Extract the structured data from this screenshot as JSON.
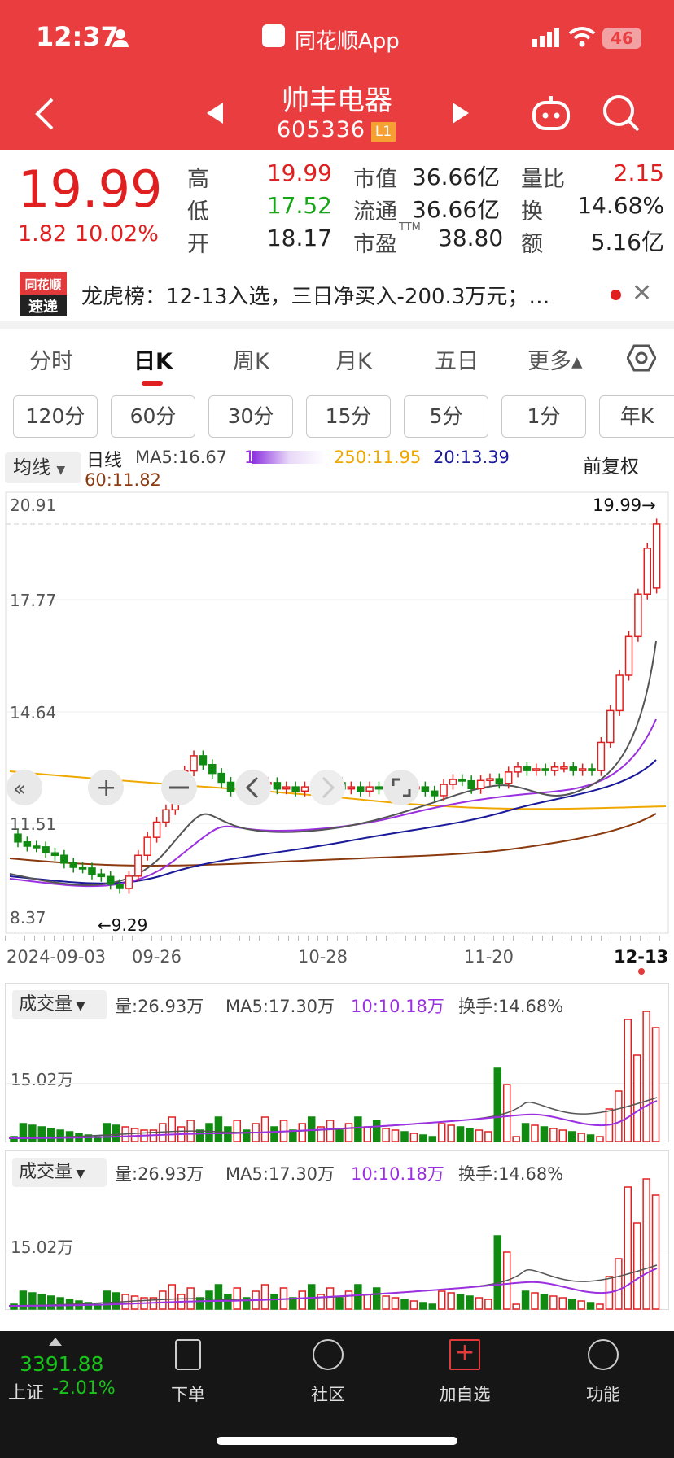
{
  "status": {
    "time": "12:37",
    "app": "同花顺App",
    "battery": "46"
  },
  "title": {
    "name": "帅丰电器",
    "code": "605336",
    "level": "L1"
  },
  "quote": {
    "price": "19.99",
    "change": "1.82",
    "change_pct": "10.02%",
    "high_label": "高",
    "high": "19.99",
    "low_label": "低",
    "low": "17.52",
    "open_label": "开",
    "open": "18.17",
    "mcap_label": "市值",
    "mcap": "36.66亿",
    "float_label": "流通",
    "float": "36.66亿",
    "pe_label": "市盈",
    "pe_sup": "TTM",
    "pe": "38.80",
    "vr_label": "量比",
    "vr": "2.15",
    "turn_label": "换",
    "turn": "14.68%",
    "amt_label": "额",
    "amt": "5.16亿"
  },
  "news": {
    "logo_top": "同花顺",
    "logo_bottom": "速递",
    "text": "龙虎榜：12-13入选，三日净买入-200.3万元；…"
  },
  "tabs": [
    "分时",
    "日K",
    "周K",
    "月K",
    "五日",
    "更多▴"
  ],
  "periods": [
    "120分",
    "60分",
    "30分",
    "15分",
    "5分",
    "1分",
    "年K"
  ],
  "legend": {
    "selector": "均线",
    "daily": "日线",
    "ma5": "MA5:16.67",
    "ma10": "1",
    "ma250": "250:11.95",
    "ma20": "20:13.39",
    "ma60": "60:11.82",
    "adjust": "前复权"
  },
  "chart_axis": {
    "y_ticks": [
      "20.91",
      "17.77",
      "14.64",
      "11.51",
      "8.37"
    ],
    "max_marker": "19.99→",
    "min_marker": "←9.29",
    "dates": [
      "2024-09-03",
      "09-26",
      "10-28",
      "11-20",
      "12-13"
    ]
  },
  "volume_panels": [
    {
      "selector": "成交量",
      "vol": "量:26.93万",
      "ma5": "MA5:17.30万",
      "ma10": "10:10.18万",
      "turnover": "换手:14.68%",
      "tick": "15.02万"
    },
    {
      "selector": "成交量",
      "vol": "量:26.93万",
      "ma5": "MA5:17.30万",
      "ma10": "10:10.18万",
      "turnover": "换手:14.68%",
      "tick": "15.02万"
    }
  ],
  "bottom": {
    "index_value": "3391.88",
    "index_name": "上证",
    "index_change": "-2.01%",
    "items": [
      "下单",
      "社区",
      "加自选",
      "功能"
    ]
  },
  "colors": {
    "up": "#e02020",
    "down": "#108a10",
    "ma5": "#555555",
    "ma10": "#9b30e0",
    "ma20": "#1a1a9a",
    "ma60": "#8b3a10",
    "ma250": "#f0a800"
  },
  "chart_data": {
    "type": "candlestick",
    "ylim": [
      8.37,
      20.91
    ],
    "last_close": 19.99,
    "period_high": 19.99,
    "period_low": 9.29,
    "ma": {
      "MA5": 16.67,
      "MA20": 13.39,
      "MA60": 11.82,
      "MA250": 11.95
    },
    "volume": {
      "last": "26.93万",
      "MA5": "17.30万",
      "MA10": "10.18万"
    }
  }
}
